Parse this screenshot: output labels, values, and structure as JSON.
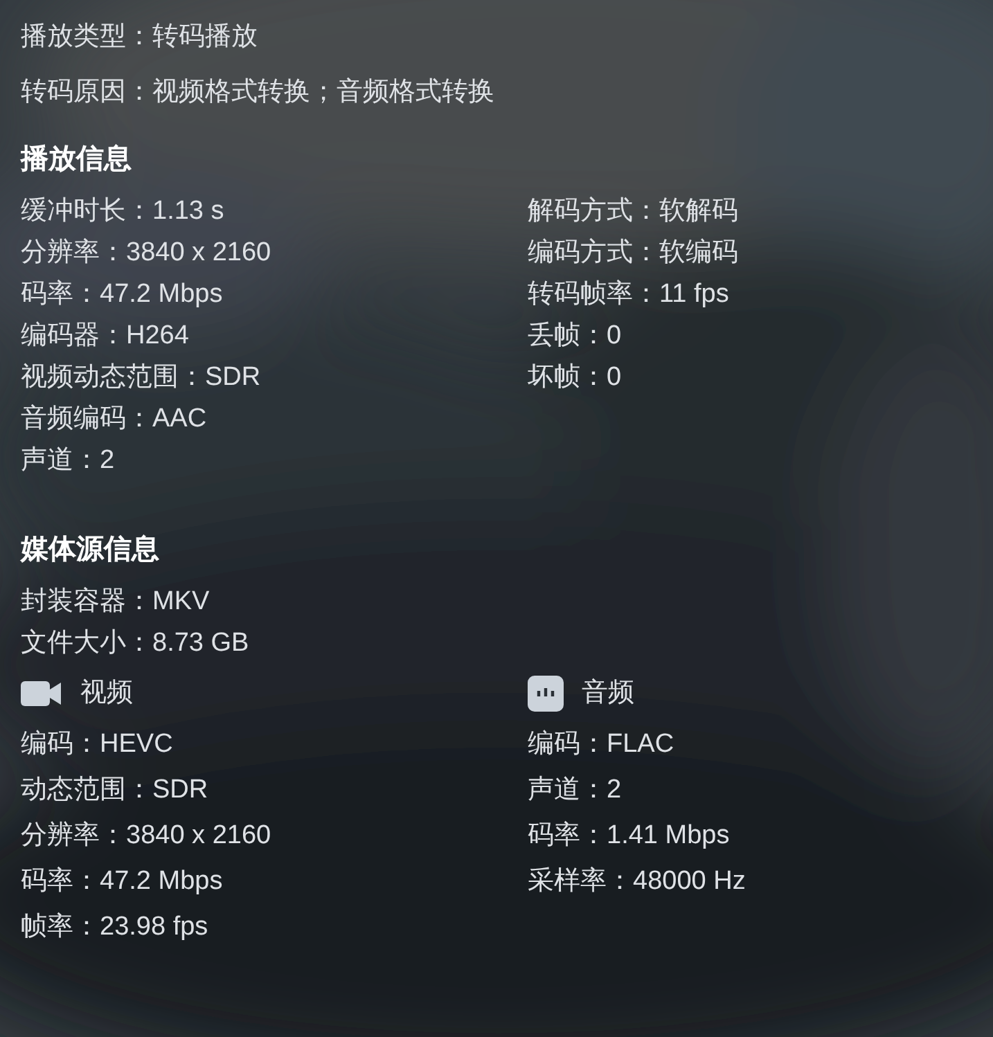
{
  "summary": [
    "播放类型：转码播放",
    "转码原因：视频格式转换；音频格式转换"
  ],
  "playback_info": {
    "title": "播放信息",
    "left": [
      "缓冲时长：1.13 s",
      "分辨率：3840 x 2160",
      "码率：47.2 Mbps",
      "编码器：H264",
      "视频动态范围：SDR",
      "音频编码：AAC",
      "声道：2"
    ],
    "right": [
      "解码方式：软解码",
      "编码方式：软编码",
      "转码帧率：11 fps",
      "丢帧：0",
      "坏帧：0"
    ]
  },
  "media_source": {
    "title": "媒体源信息",
    "lines": [
      "封装容器：MKV",
      "文件大小：8.73 GB"
    ],
    "streams": [
      {
        "kind": "video",
        "title": "视频",
        "lines": [
          "编码：HEVC",
          "动态范围：SDR",
          "分辨率：3840 x 2160",
          "码率：47.2 Mbps",
          "帧率：23.98 fps"
        ]
      },
      {
        "kind": "audio",
        "title": "音频",
        "lines": [
          "编码：FLAC",
          "声道：2",
          "码率：1.41 Mbps",
          "采样率：48000 Hz"
        ]
      }
    ]
  }
}
